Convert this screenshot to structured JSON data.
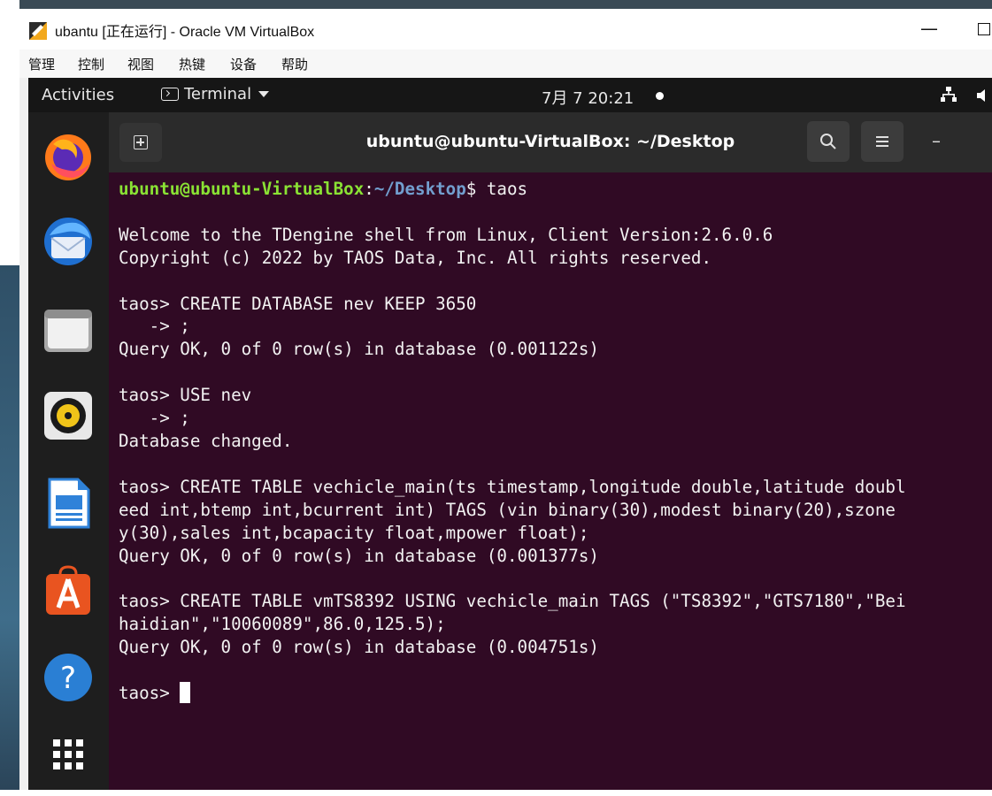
{
  "vbox": {
    "title": "ubantu [正在运行] - Oracle VM VirtualBox",
    "minimize": "—",
    "menu": [
      "管理",
      "控制",
      "视图",
      "热键",
      "设备",
      "帮助"
    ]
  },
  "topbar": {
    "activities": "Activities",
    "app_menu": "Terminal",
    "clock": "7月 7  20:21"
  },
  "dock": {
    "items": [
      "firefox-icon",
      "thunderbird-icon",
      "files-icon",
      "rhythmbox-icon",
      "libreoffice-writer-icon",
      "ubuntu-software-icon",
      "help-icon",
      "show-applications-icon"
    ]
  },
  "terminal": {
    "title": "ubuntu@ubuntu-VirtualBox: ~/Desktop",
    "prompt_user": "ubuntu@ubuntu-VirtualBox",
    "prompt_sep": ":",
    "prompt_path": "~/Desktop",
    "prompt_cmd": "$ taos",
    "lines": [
      "",
      "Welcome to the TDengine shell from Linux, Client Version:2.6.0.6",
      "Copyright (c) 2022 by TAOS Data, Inc. All rights reserved.",
      "",
      "taos> CREATE DATABASE nev KEEP 3650",
      "   -> ;",
      "Query OK, 0 of 0 row(s) in database (0.001122s)",
      "",
      "taos> USE nev",
      "   -> ;",
      "Database changed.",
      "",
      "taos> CREATE TABLE vechicle_main(ts timestamp,longitude double,latitude doubl",
      "eed int,btemp int,bcurrent int) TAGS (vin binary(30),modest binary(20),szone",
      "y(30),sales int,bcapacity float,mpower float);",
      "Query OK, 0 of 0 row(s) in database (0.001377s)",
      "",
      "taos> CREATE TABLE vmTS8392 USING vechicle_main TAGS (\"TS8392\",\"GTS7180\",\"Bei",
      "haidian\",\"10060089\",86.0,125.5);",
      "Query OK, 0 of 0 row(s) in database (0.004751s)",
      ""
    ],
    "current_prompt": "taos> "
  }
}
